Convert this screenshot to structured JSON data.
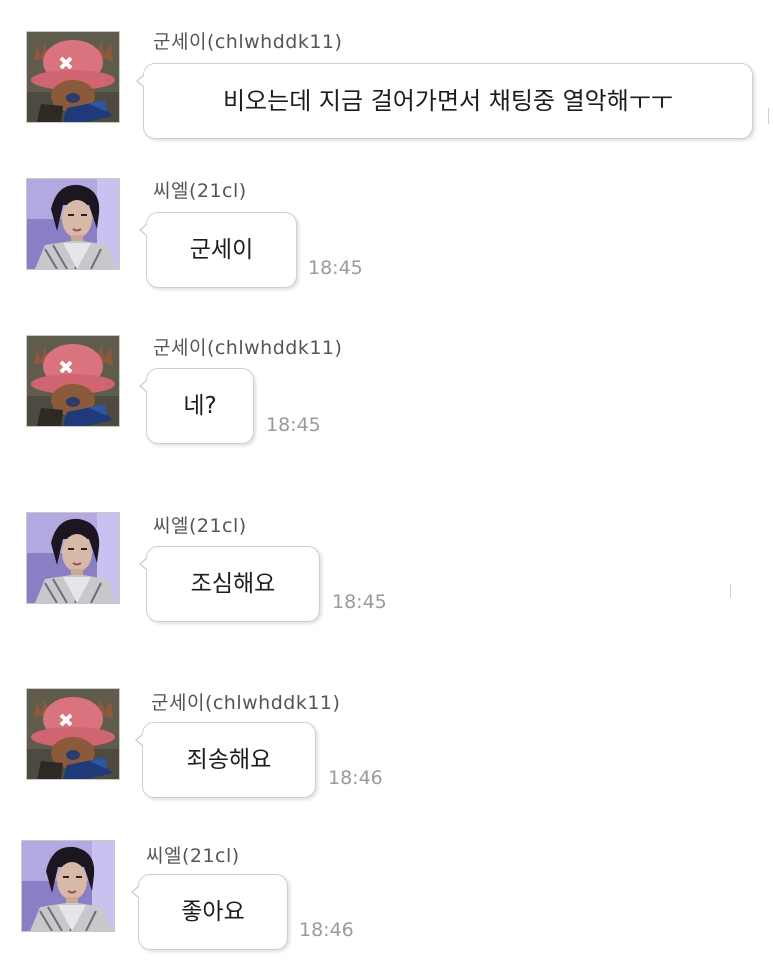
{
  "messages": [
    {
      "sender": "군세이(chlwhddk11)",
      "avatar": "chopper-avatar-icon",
      "text": "비오는데 지금 걸어가면서 채팅중 열악해ㅜㅜ",
      "time": ""
    },
    {
      "sender": "씨엘(21cl)",
      "avatar": "singer-avatar-icon",
      "text": "군세이",
      "time": "18:45"
    },
    {
      "sender": "군세이(chlwhddk11)",
      "avatar": "chopper-avatar-icon",
      "text": "네?",
      "time": "18:45"
    },
    {
      "sender": "씨엘(21cl)",
      "avatar": "singer-avatar-icon",
      "text": "조심해요",
      "time": "18:45"
    },
    {
      "sender": "군세이(chlwhddk11)",
      "avatar": "chopper-avatar-icon",
      "text": "죄송해요",
      "time": "18:46"
    },
    {
      "sender": "씨엘(21cl)",
      "avatar": "singer-avatar-icon",
      "text": "좋아요",
      "time": "18:46"
    }
  ],
  "colors": {
    "bubble_border": "#cfcfcf",
    "sender_text": "#555555",
    "time_text": "#9a9a9a",
    "chopper_hat": "#d9737e",
    "chopper_bg": "#5e5a4c"
  }
}
